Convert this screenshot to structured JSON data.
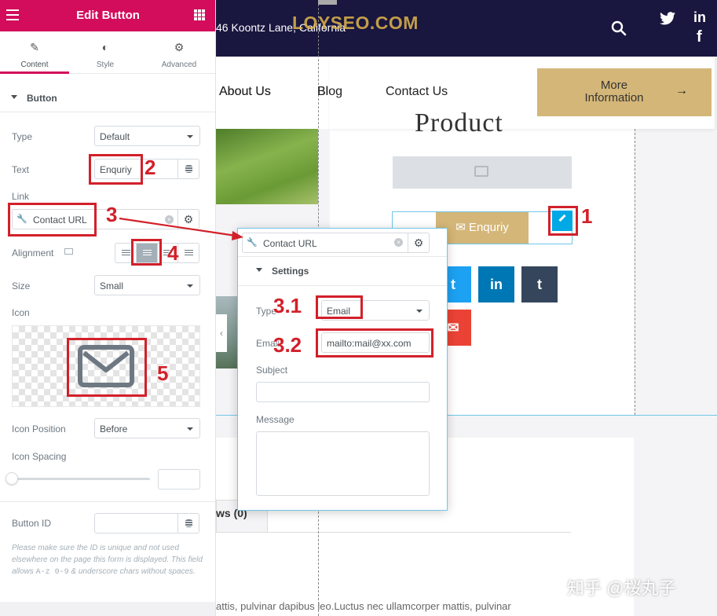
{
  "panel": {
    "title": "Edit Button",
    "tabs": [
      {
        "label": "Content",
        "icon": "pencil-icon"
      },
      {
        "label": "Style",
        "icon": "half-circle-icon"
      },
      {
        "label": "Advanced",
        "icon": "gear-icon"
      }
    ],
    "section_title": "Button",
    "type_label": "Type",
    "type_value": "Default",
    "text_label": "Text",
    "text_value": "Enquriy",
    "link_label": "Link",
    "link_value": "Contact URL",
    "alignment_label": "Alignment",
    "size_label": "Size",
    "size_value": "Small",
    "icon_label": "Icon",
    "icon_position_label": "Icon Position",
    "icon_position_value": "Before",
    "icon_spacing_label": "Icon Spacing",
    "button_id_label": "Button ID",
    "note_parts": [
      "Please make sure the ID is unique and not used elsewhere on the page this form is displayed. This field allows ",
      "A-z 0-9",
      " & underscore chars without spaces."
    ]
  },
  "popover": {
    "link_value": "Contact URL",
    "section_title": "Settings",
    "type_label": "Type",
    "type_value": "Email",
    "email_label": "Email",
    "email_value": "mailto:mail@xx.com",
    "subject_label": "Subject",
    "message_label": "Message"
  },
  "preview": {
    "address": "46 Koontz Lane, California",
    "watermark": "LOYSEO.COM",
    "nav": [
      "About Us",
      "Blog",
      "Contact Us"
    ],
    "more_button": "More Information",
    "more_arrow": "→",
    "product_title": "Product",
    "enquiry_button": "Enquriy",
    "reviews_tab": "ws (0)",
    "lorem": "attis, pulvinar dapibus leo.Luctus nec ullamcorper mattis, pulvinar",
    "corner_watermark": "知乎 @桜丸子"
  },
  "annotations": [
    "1",
    "2",
    "3",
    "4",
    "5",
    "3.1",
    "3.2"
  ],
  "colors": {
    "brand": "#d30c5c",
    "annotation": "#d2202a",
    "gold": "#d4b678",
    "navy": "#19163f",
    "edit_blue": "#00a8e6"
  }
}
